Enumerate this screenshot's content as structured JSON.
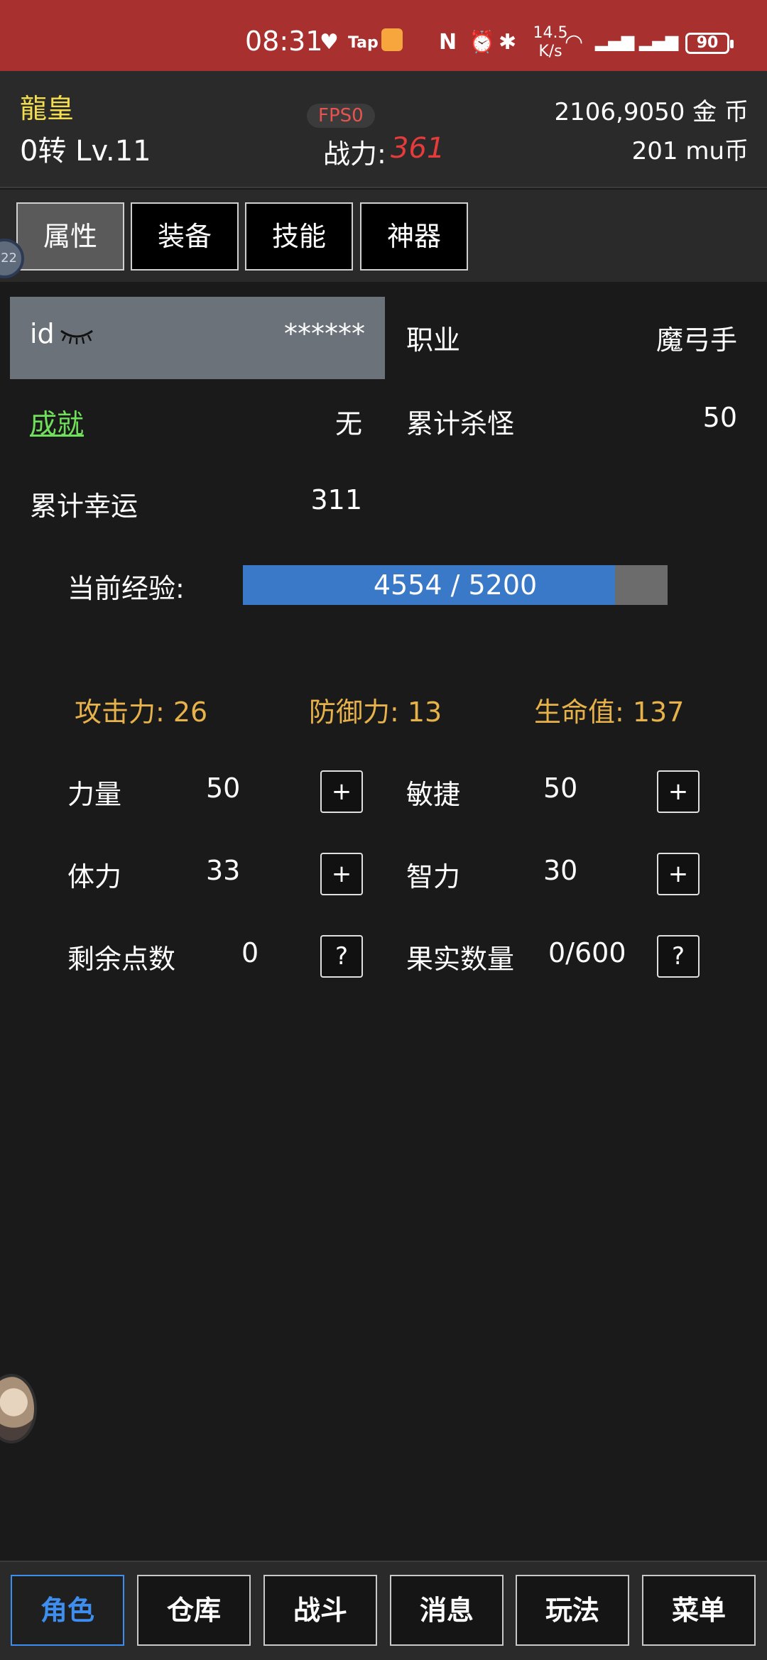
{
  "status_bar": {
    "time": "08:31",
    "net_speed_value": "14.5",
    "net_speed_unit": "K/s",
    "battery": "90",
    "icons": [
      "health-icon",
      "taptap-icon",
      "app-notify-icon",
      "nfc-icon",
      "alarm-icon",
      "bluetooth-icon",
      "wifi-icon",
      "signal-4g-icon",
      "signal-5g-icon",
      "battery-icon"
    ]
  },
  "header": {
    "player_name": "龍皇",
    "player_level": "0转 Lv.11",
    "fps": "FPS0",
    "power_label": "战力:",
    "power_value": "361",
    "gold": "2106,9050 金 币",
    "mu": "201 mu币"
  },
  "tabs": [
    {
      "label": "属性",
      "active": true
    },
    {
      "label": "装备",
      "active": false
    },
    {
      "label": "技能",
      "active": false
    },
    {
      "label": "神器",
      "active": false
    }
  ],
  "side_badge": "22",
  "info": {
    "id_label": "id",
    "id_value": "******",
    "job_label": "职业",
    "job_value": "魔弓手",
    "achievement_label": "成就",
    "achievement_value": "无",
    "kills_label": "累计杀怪",
    "kills_value": "50",
    "luck_label": "累计幸运",
    "luck_value": "311"
  },
  "exp": {
    "label": "当前经验:",
    "text": "4554 / 5200",
    "current": 4554,
    "max": 5200
  },
  "stats": {
    "attack": "攻击力: 26",
    "defense": "防御力: 13",
    "hp": "生命值: 137"
  },
  "attributes": {
    "strength_label": "力量",
    "strength_value": "50",
    "agility_label": "敏捷",
    "agility_value": "50",
    "stamina_label": "体力",
    "stamina_value": "33",
    "intellect_label": "智力",
    "intellect_value": "30",
    "points_label": "剩余点数",
    "points_value": "0",
    "fruit_label": "果实数量",
    "fruit_value": "0/600",
    "plus": "+",
    "help": "?"
  },
  "bottom_nav": [
    {
      "label": "角色",
      "active": true
    },
    {
      "label": "仓库",
      "active": false
    },
    {
      "label": "战斗",
      "active": false
    },
    {
      "label": "消息",
      "active": false
    },
    {
      "label": "玩法",
      "active": false
    },
    {
      "label": "菜单",
      "active": false
    }
  ],
  "colors": {
    "status_bar": "#a8302e",
    "name": "#f3dc4e",
    "power": "#e53b3b",
    "achievement": "#6ee05a",
    "stat": "#e8b24a",
    "exp_fill": "#3a78c8",
    "nav_active": "#3e8ef0"
  }
}
